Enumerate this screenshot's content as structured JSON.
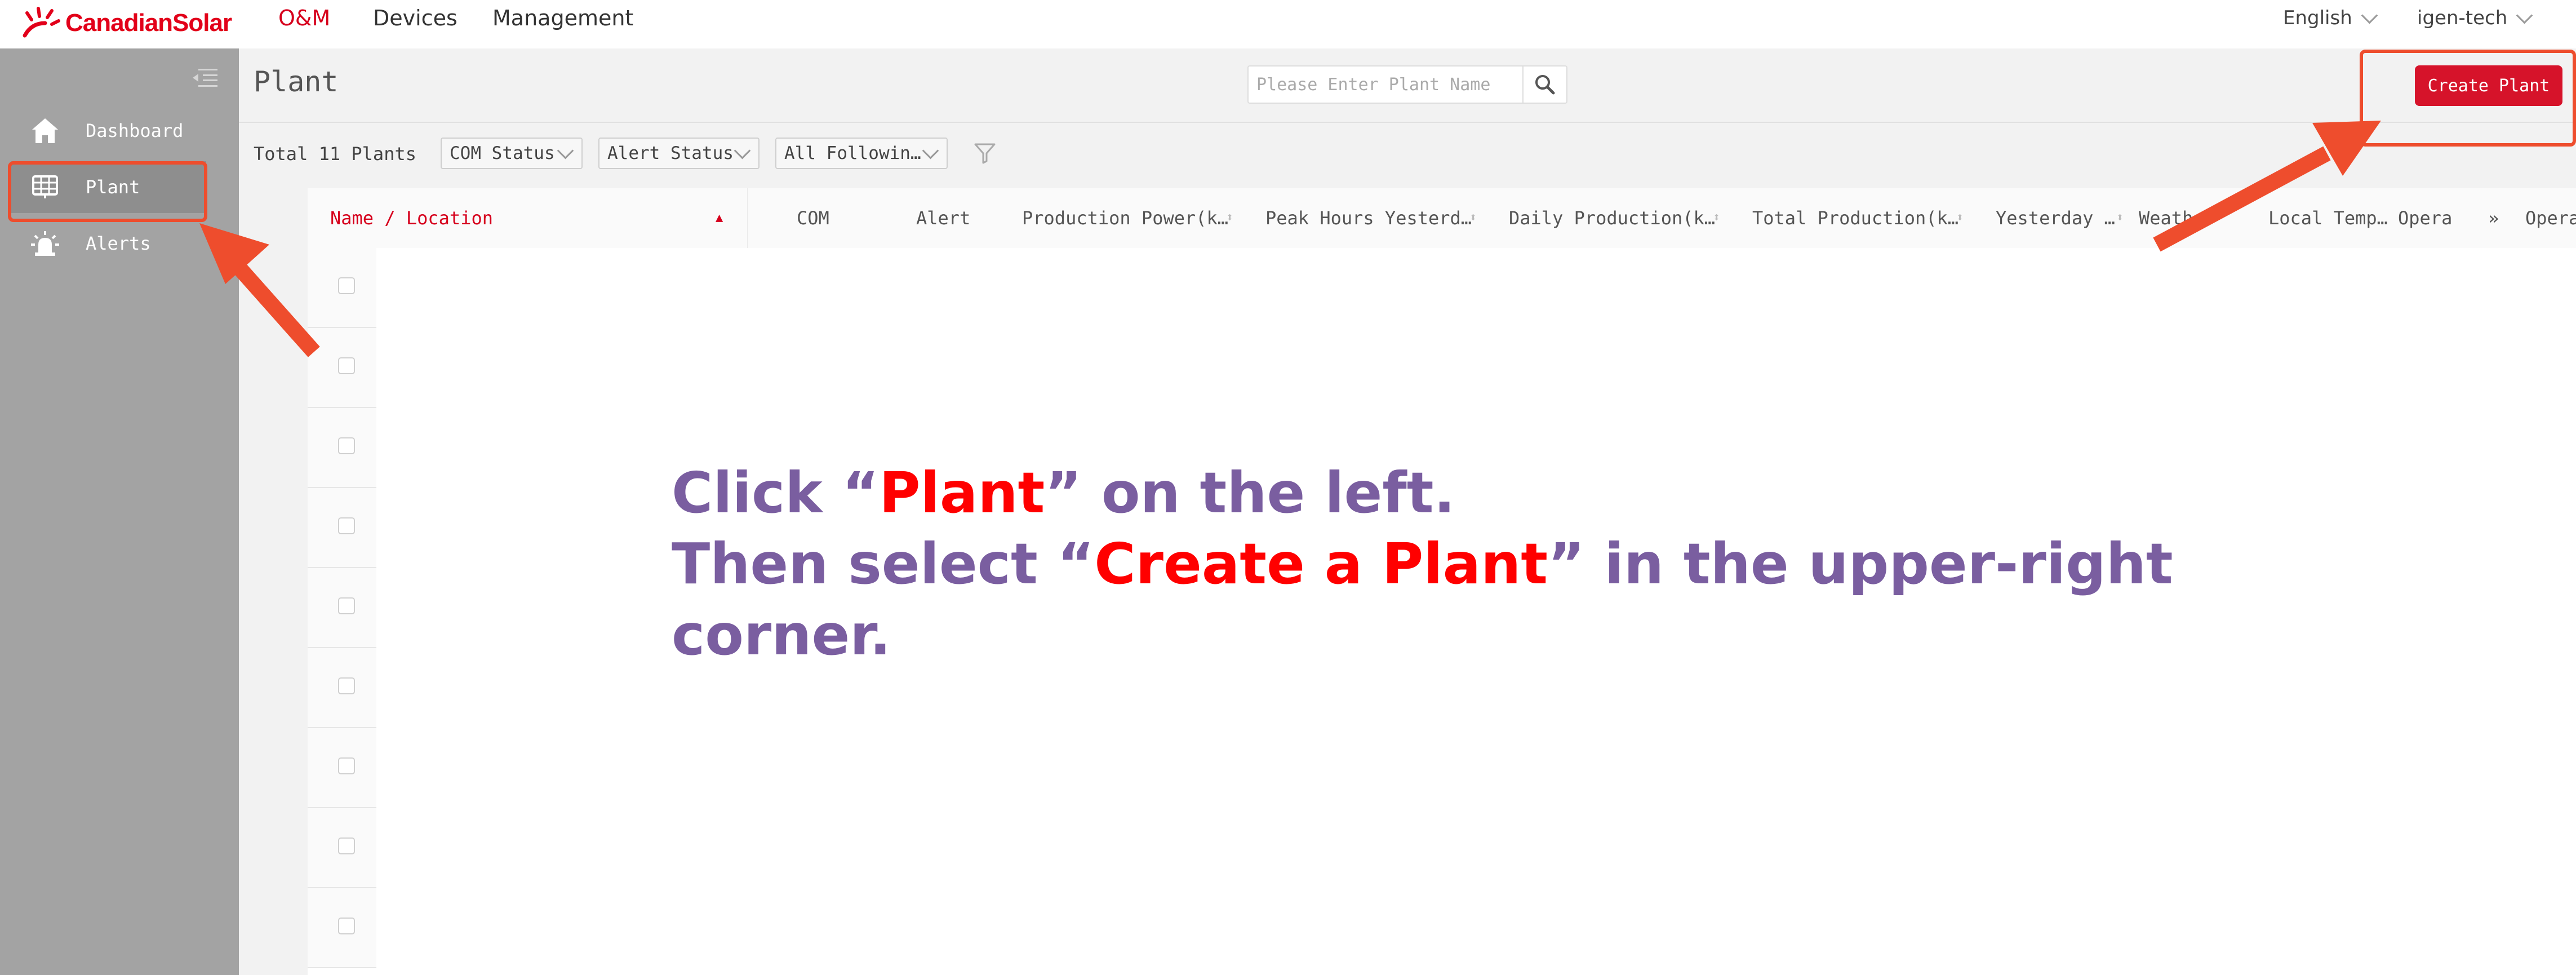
{
  "brand": {
    "name": "CanadianSolar",
    "color": "#e2001a"
  },
  "top_nav": [
    {
      "label": "O&M",
      "active": true
    },
    {
      "label": "Devices",
      "active": false
    },
    {
      "label": "Management",
      "active": false
    }
  ],
  "top_right": {
    "language": "English",
    "user": "igen-tech"
  },
  "sidebar": {
    "items": [
      {
        "label": "Dashboard",
        "icon": "home-icon"
      },
      {
        "label": "Plant",
        "icon": "solar-panel-icon",
        "selected": true
      },
      {
        "label": "Alerts",
        "icon": "alarm-light-icon"
      }
    ]
  },
  "header": {
    "title": "Plant",
    "search_placeholder": "Please Enter Plant Name",
    "create_label": "Create Plant"
  },
  "toolbar": {
    "total": "Total 11 Plants",
    "filters": [
      "COM Status",
      "Alert Status",
      "All Followin…"
    ]
  },
  "table": {
    "columns": [
      "Name / Location",
      "COM",
      "Alert",
      "Production Power(k…",
      "Peak Hours Yesterd…",
      "Daily Production(k…",
      "Total Production(k…",
      "Yesterday …",
      "Weather",
      "Local Temp…",
      "Opera",
      "Operation"
    ],
    "expand_symbol": "»"
  },
  "instruction": {
    "line1_prefix": "Click “",
    "line1_highlight": "Plant",
    "line1_suffix": "” on the left.",
    "line2_prefix": "Then select “",
    "line2_highlight": "Create a Plant",
    "line2_suffix": "” in the upper-right",
    "line3": "corner."
  },
  "colors": {
    "accent": "#d6132a",
    "annotation": "#ee4d2d",
    "instruction_text": "#7a5ea0",
    "instruction_highlight": "#ff0000",
    "sidebar_bg": "#a3a3a3"
  }
}
